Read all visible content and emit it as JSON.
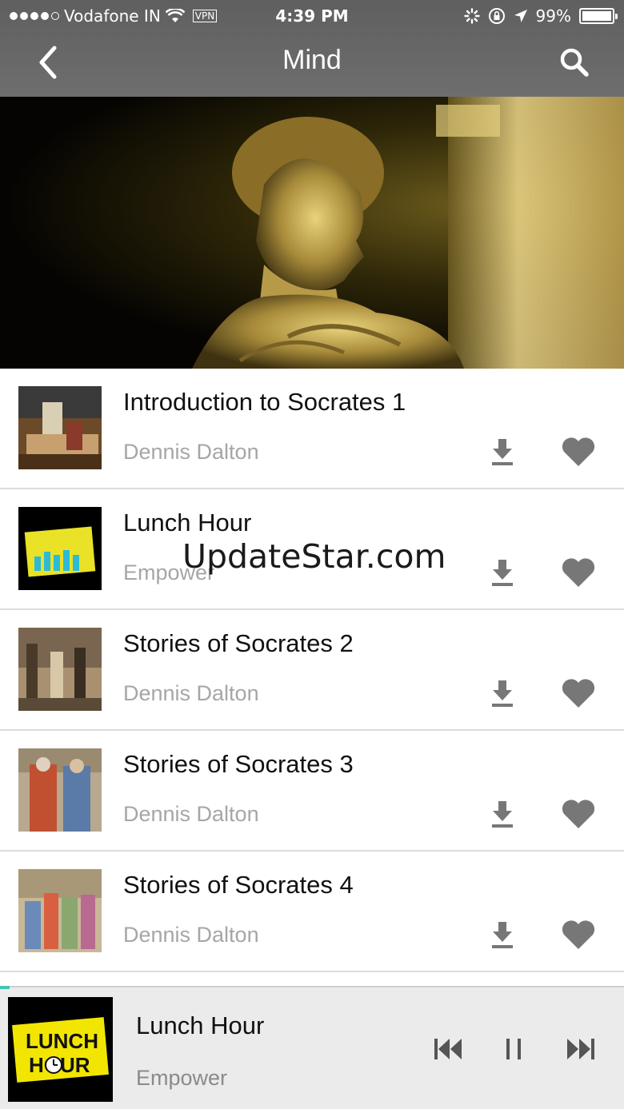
{
  "status_bar": {
    "carrier": "Vodafone IN",
    "vpn": "VPN",
    "time": "4:39 PM",
    "battery": "99%",
    "battery_level": 0.99
  },
  "nav": {
    "title": "Mind",
    "back_icon": "chevron-left-icon",
    "search_icon": "search-icon"
  },
  "episodes": [
    {
      "title": "Introduction to Socrates 1",
      "author": "Dennis Dalton"
    },
    {
      "title": "Lunch Hour",
      "author": "Empower"
    },
    {
      "title": "Stories of Socrates 2",
      "author": "Dennis Dalton"
    },
    {
      "title": "Stories of Socrates 3",
      "author": "Dennis Dalton"
    },
    {
      "title": "Stories of Socrates 4",
      "author": "Dennis Dalton"
    }
  ],
  "watermark": "UpdateStar.com",
  "player": {
    "title": "Lunch Hour",
    "author": "Empower",
    "progress": 0.015,
    "logo_text_top": "LUNCH",
    "logo_text_bottom": "HOUR"
  },
  "colors": {
    "accent": "#3cc7b0",
    "icon_grey": "#777777",
    "nav_bg": "#666666"
  }
}
